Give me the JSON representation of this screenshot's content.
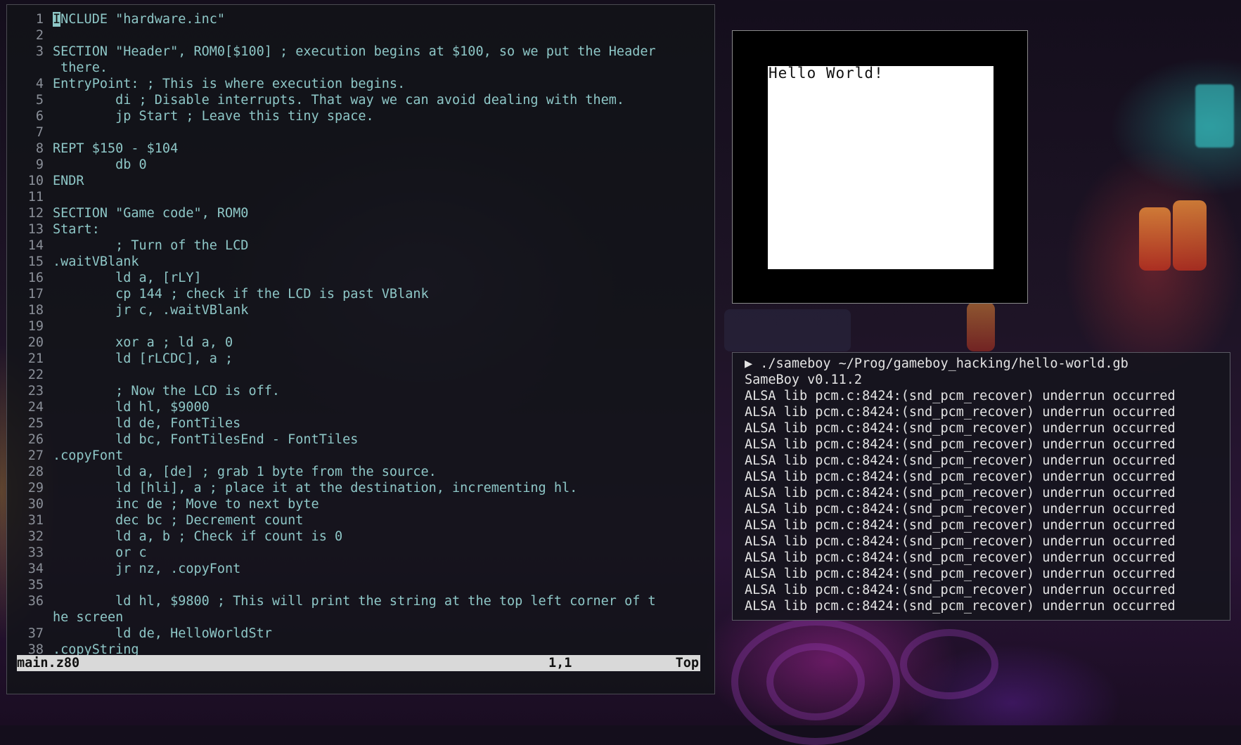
{
  "editor": {
    "lines": [
      {
        "n": "1",
        "text": "INCLUDE \"hardware.inc\""
      },
      {
        "n": "2",
        "text": ""
      },
      {
        "n": "3",
        "text": "SECTION \"Header\", ROM0[$100] ; execution begins at $100, so we put the Header"
      },
      {
        "n": "",
        "text": " there."
      },
      {
        "n": "4",
        "text": "EntryPoint: ; This is where execution begins."
      },
      {
        "n": "5",
        "text": "        di ; Disable interrupts. That way we can avoid dealing with them."
      },
      {
        "n": "6",
        "text": "        jp Start ; Leave this tiny space."
      },
      {
        "n": "7",
        "text": ""
      },
      {
        "n": "8",
        "text": "REPT $150 - $104"
      },
      {
        "n": "9",
        "text": "        db 0"
      },
      {
        "n": "10",
        "text": "ENDR"
      },
      {
        "n": "11",
        "text": ""
      },
      {
        "n": "12",
        "text": "SECTION \"Game code\", ROM0"
      },
      {
        "n": "13",
        "text": "Start:"
      },
      {
        "n": "14",
        "text": "        ; Turn of the LCD"
      },
      {
        "n": "15",
        "text": ".waitVBlank"
      },
      {
        "n": "16",
        "text": "        ld a, [rLY]"
      },
      {
        "n": "17",
        "text": "        cp 144 ; check if the LCD is past VBlank"
      },
      {
        "n": "18",
        "text": "        jr c, .waitVBlank"
      },
      {
        "n": "19",
        "text": ""
      },
      {
        "n": "20",
        "text": "        xor a ; ld a, 0"
      },
      {
        "n": "21",
        "text": "        ld [rLCDC], a ;"
      },
      {
        "n": "22",
        "text": ""
      },
      {
        "n": "23",
        "text": "        ; Now the LCD is off."
      },
      {
        "n": "24",
        "text": "        ld hl, $9000"
      },
      {
        "n": "25",
        "text": "        ld de, FontTiles"
      },
      {
        "n": "26",
        "text": "        ld bc, FontTilesEnd - FontTiles"
      },
      {
        "n": "27",
        "text": ".copyFont"
      },
      {
        "n": "28",
        "text": "        ld a, [de] ; grab 1 byte from the source."
      },
      {
        "n": "29",
        "text": "        ld [hli], a ; place it at the destination, incrementing hl."
      },
      {
        "n": "30",
        "text": "        inc de ; Move to next byte"
      },
      {
        "n": "31",
        "text": "        dec bc ; Decrement count"
      },
      {
        "n": "32",
        "text": "        ld a, b ; Check if count is 0"
      },
      {
        "n": "33",
        "text": "        or c"
      },
      {
        "n": "34",
        "text": "        jr nz, .copyFont"
      },
      {
        "n": "35",
        "text": ""
      },
      {
        "n": "36",
        "text": "        ld hl, $9800 ; This will print the string at the top left corner of t"
      },
      {
        "n": "",
        "text": "he screen"
      },
      {
        "n": "37",
        "text": "        ld de, HelloWorldStr"
      },
      {
        "n": "38",
        "text": ".copyString"
      }
    ],
    "status": {
      "file": "main.z80",
      "position": "1,1",
      "scroll": "Top"
    }
  },
  "emulator": {
    "screen_text": "Hello World!"
  },
  "terminal": {
    "lines": [
      "▶ ./sameboy ~/Prog/gameboy_hacking/hello-world.gb",
      "SameBoy v0.11.2",
      "ALSA lib pcm.c:8424:(snd_pcm_recover) underrun occurred",
      "ALSA lib pcm.c:8424:(snd_pcm_recover) underrun occurred",
      "ALSA lib pcm.c:8424:(snd_pcm_recover) underrun occurred",
      "ALSA lib pcm.c:8424:(snd_pcm_recover) underrun occurred",
      "ALSA lib pcm.c:8424:(snd_pcm_recover) underrun occurred",
      "ALSA lib pcm.c:8424:(snd_pcm_recover) underrun occurred",
      "ALSA lib pcm.c:8424:(snd_pcm_recover) underrun occurred",
      "ALSA lib pcm.c:8424:(snd_pcm_recover) underrun occurred",
      "ALSA lib pcm.c:8424:(snd_pcm_recover) underrun occurred",
      "ALSA lib pcm.c:8424:(snd_pcm_recover) underrun occurred",
      "ALSA lib pcm.c:8424:(snd_pcm_recover) underrun occurred",
      "ALSA lib pcm.c:8424:(snd_pcm_recover) underrun occurred",
      "ALSA lib pcm.c:8424:(snd_pcm_recover) underrun occurred",
      "ALSA lib pcm.c:8424:(snd_pcm_recover) underrun occurred"
    ]
  },
  "colors": {
    "code_text": "#8ec7c7",
    "line_numbers": "#8a8f98",
    "status_bar": "#d9d9d9",
    "terminal_text": "#e4e4e4"
  }
}
